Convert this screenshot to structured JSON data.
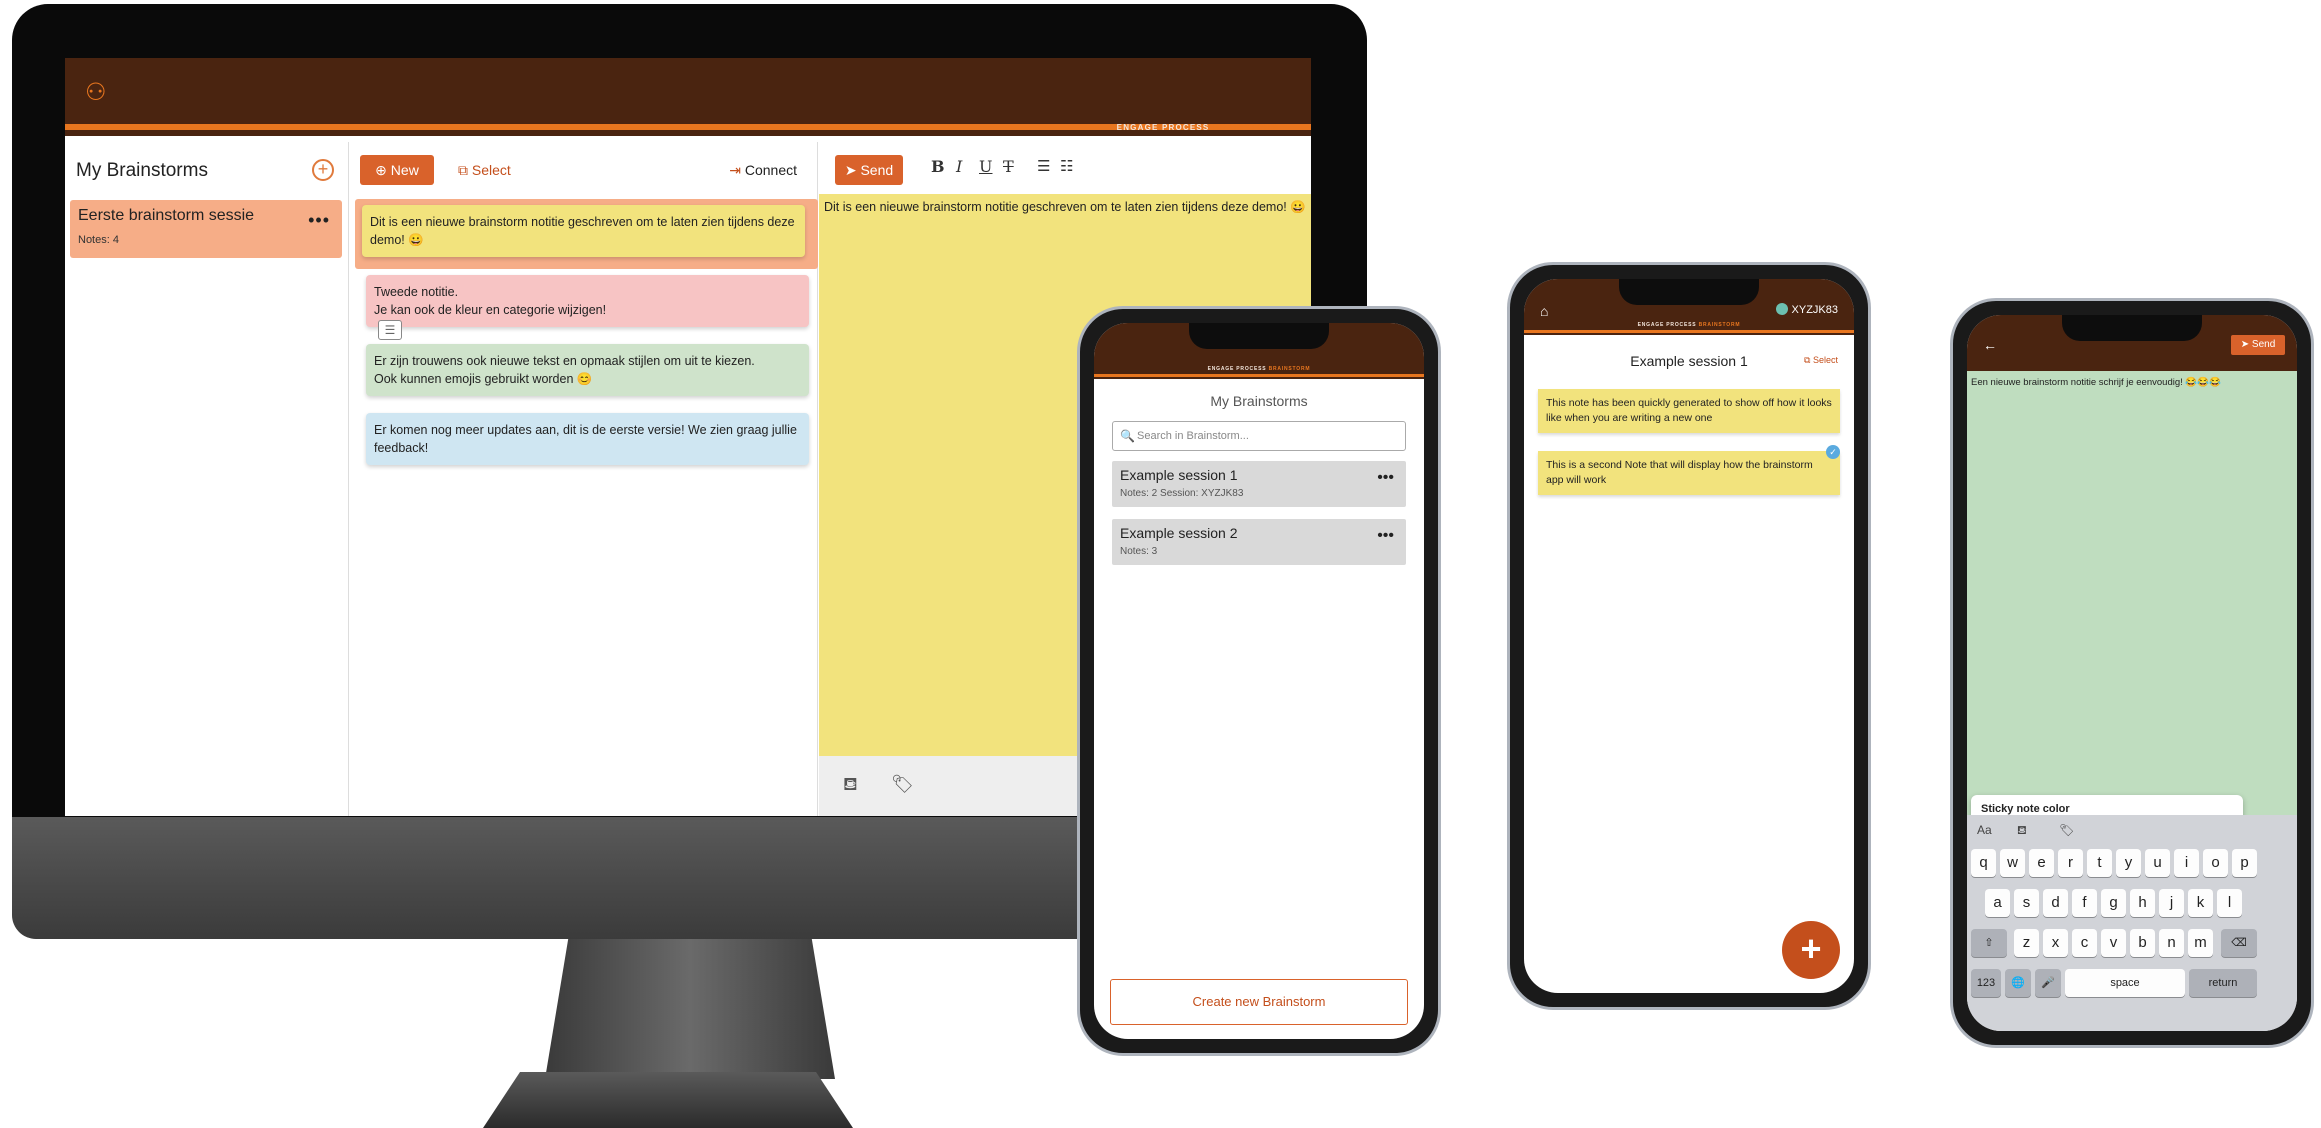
{
  "desktop": {
    "brand_main": "ENGAGE PROCESS",
    "brand_accent": "BRAINSTORM",
    "sessions_title": "My Brainstorms",
    "session": {
      "title": "Eerste brainstorm sessie",
      "subtitle": "Notes: 4"
    },
    "toolbar": {
      "new_label": "New",
      "select_label": "Select",
      "connect_label": "Connect"
    },
    "notes": [
      {
        "text": "Dit is een nieuwe brainstorm notitie geschreven om te laten zien tijdens deze demo! 😀",
        "color": "#f2e37d"
      },
      {
        "text": "Tweede notitie.\nJe kan ook de kleur en categorie wijzigen!",
        "color": "#f7c4c4"
      },
      {
        "text": "Er zijn trouwens ook nieuwe tekst en opmaak stijlen om uit te kiezen.\nOok kunnen emojis gebruikt worden 😊",
        "color": "#cfe3cb"
      },
      {
        "text": "Er komen nog meer updates aan, dit is de eerste versie! We zien graag jullie feedback!",
        "color": "#cfe6f2"
      }
    ],
    "editor": {
      "send_label": "Send",
      "bold": "B",
      "italic": "I",
      "underline": "U",
      "strike": "T",
      "text": "Dit is een nieuwe brainstorm notitie geschreven om te laten zien tijdens deze demo! 😀"
    }
  },
  "phone1": {
    "brand_main": "ENGAGE PROCESS",
    "brand_accent": "BRAINSTORM",
    "title": "My Brainstorms",
    "search_placeholder": "Search in Brainstorm...",
    "sessions": [
      {
        "title": "Example session 1",
        "subtitle": "Notes: 2   Session: XYZJK83"
      },
      {
        "title": "Example session 2",
        "subtitle": "Notes: 3"
      }
    ],
    "create_label": "Create new Brainstorm"
  },
  "phone2": {
    "brand_main": "ENGAGE PROCESS",
    "brand_accent": "BRAINSTORM",
    "session_code": "XYZJK83",
    "title": "Example session 1",
    "select_label": "Select",
    "notes": [
      {
        "text": "This note has been quickly generated to show off how it looks like when you are writing a new one"
      },
      {
        "text": "This is a second Note that will display how the brainstorm app will work"
      }
    ],
    "fab": "+"
  },
  "phone3": {
    "send_label": "Send",
    "note_text": "Een nieuwe brainstorm notitie schrijf je eenvoudig! 😂😂😂",
    "popup_title": "Sticky note color",
    "colors": [
      "#f2e37d",
      "#b9d9ec",
      "#bfddbf",
      "#f2c97a",
      "#d9c3f0",
      "#f4a5a5",
      "#cfcfcf"
    ],
    "kb_aa": "Aa",
    "row1": [
      "q",
      "w",
      "e",
      "r",
      "t",
      "y",
      "u",
      "i",
      "o",
      "p"
    ],
    "row2": [
      "a",
      "s",
      "d",
      "f",
      "g",
      "h",
      "j",
      "k",
      "l"
    ],
    "row3": [
      "z",
      "x",
      "c",
      "v",
      "b",
      "n",
      "m"
    ],
    "num_label": "123",
    "space_label": "space",
    "return_label": "return"
  }
}
